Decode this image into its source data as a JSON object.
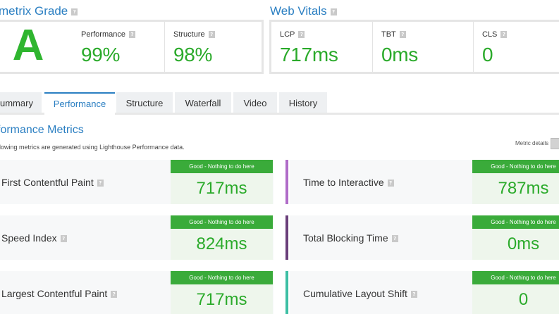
{
  "grade": {
    "title": "metrix Grade",
    "letter": "A",
    "performance": {
      "label": "Performance",
      "value": "99%"
    },
    "structure": {
      "label": "Structure",
      "value": "98%"
    }
  },
  "web_vitals": {
    "title": "Web Vitals",
    "lcp": {
      "label": "LCP",
      "value": "717ms"
    },
    "tbt": {
      "label": "TBT",
      "value": "0ms"
    },
    "cls": {
      "label": "CLS",
      "value": "0"
    }
  },
  "help_glyph": "?",
  "tabs": [
    {
      "label": "ummary"
    },
    {
      "label": "Performance"
    },
    {
      "label": "Structure"
    },
    {
      "label": "Waterfall"
    },
    {
      "label": "Video"
    },
    {
      "label": "History"
    }
  ],
  "metrics_section": {
    "title": "formance Metrics",
    "description": "llowing metrics are generated using Lighthouse Performance data.",
    "details_label": "Metric details"
  },
  "metrics": [
    {
      "name": "First Contentful Paint",
      "status": "Good - Nothing to do here",
      "value": "717ms"
    },
    {
      "name": "Time to Interactive",
      "status": "Good - Nothing to do here",
      "value": "787ms",
      "color": "#b06cc8"
    },
    {
      "name": "Speed Index",
      "status": "Good - Nothing to do here",
      "value": "824ms"
    },
    {
      "name": "Total Blocking Time",
      "status": "Good - Nothing to do here",
      "value": "0ms",
      "color": "#6a3f7a"
    },
    {
      "name": "Largest Contentful Paint",
      "status": "Good - Nothing to do here",
      "value": "717ms"
    },
    {
      "name": "Cumulative Layout Shift",
      "status": "Good - Nothing to do here",
      "value": "0",
      "color": "#3dbfa4"
    }
  ],
  "colors": {
    "accent": "#2b7fc2",
    "good": "#2aaa2a",
    "good_banner": "#3aab3a"
  }
}
